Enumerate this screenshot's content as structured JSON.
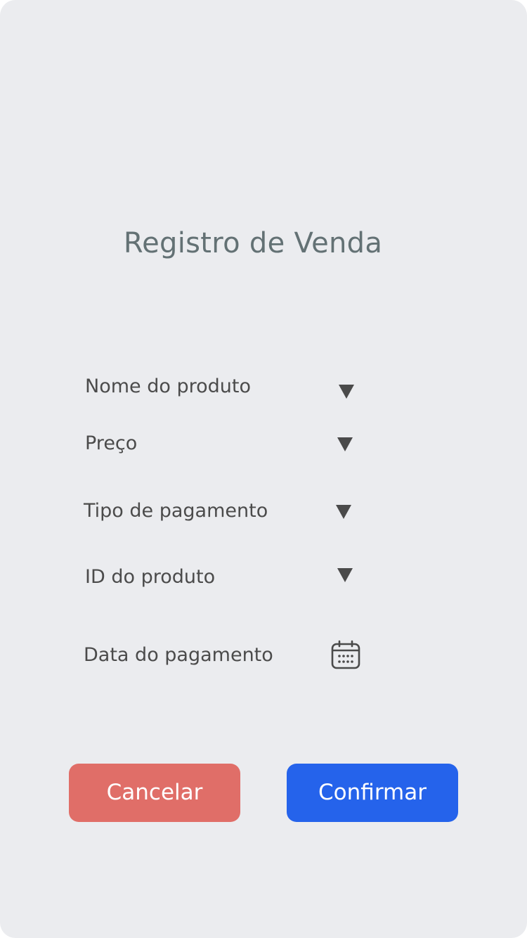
{
  "page": {
    "title": "Registro de Venda"
  },
  "form": {
    "fields": [
      {
        "label": "Nome do produto",
        "icon": "chevron-down-icon"
      },
      {
        "label": "Preço",
        "icon": "chevron-down-icon"
      },
      {
        "label": "Tipo de pagamento",
        "icon": "chevron-down-icon"
      },
      {
        "label": "ID do produto",
        "icon": "chevron-down-icon"
      },
      {
        "label": "Data do pagamento",
        "icon": "calendar-icon"
      }
    ]
  },
  "actions": {
    "cancel_label": "Cancelar",
    "confirm_label": "Confirmar"
  },
  "colors": {
    "background": "#ebecef",
    "title": "#637174",
    "cancel": "#e06e68",
    "confirm": "#2563eb"
  }
}
